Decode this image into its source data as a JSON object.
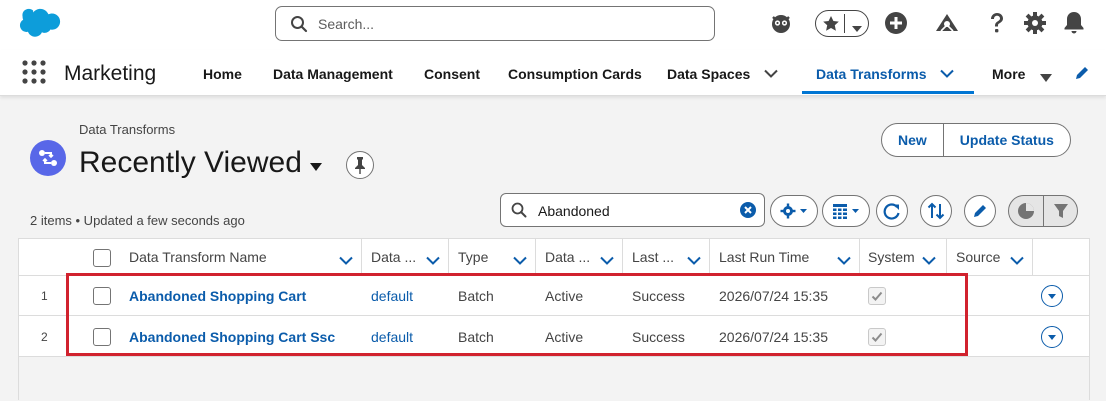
{
  "header": {
    "search_placeholder": "Search...",
    "icons": [
      "agent-icon",
      "favorites-star-icon",
      "add-icon",
      "trailhead-icon",
      "help-icon",
      "setup-gear-icon",
      "notifications-bell-icon"
    ]
  },
  "nav": {
    "app_name": "Marketing",
    "items": [
      {
        "label": "Home"
      },
      {
        "label": "Data Management"
      },
      {
        "label": "Consent"
      },
      {
        "label": "Consumption Cards"
      },
      {
        "label": "Data Spaces"
      },
      {
        "label": "Data Transforms"
      }
    ],
    "more_label": "More",
    "active": "Data Transforms",
    "accent": "#0176d3"
  },
  "list_view": {
    "breadcrumb": "Data Transforms",
    "title": "Recently Viewed",
    "meta": "2 items • Updated a few seconds ago",
    "buttons": {
      "new": "New",
      "update_status": "Update Status"
    },
    "search_value": "Abandoned"
  },
  "table": {
    "columns": [
      "Data Transform Name",
      "Data ...",
      "Type",
      "Data ...",
      "Last ...",
      "Last Run Time",
      "System",
      "Source"
    ],
    "rows": [
      {
        "num": "1",
        "name": "Abandoned Shopping Cart",
        "dataspace": "default",
        "type": "Batch",
        "status": "Active",
        "last_status": "Success",
        "last_run": "2026/07/24 15:35",
        "system": true,
        "source": ""
      },
      {
        "num": "2",
        "name": "Abandoned Shopping Cart Ssc",
        "dataspace": "default",
        "type": "Batch",
        "status": "Active",
        "last_status": "Success",
        "last_run": "2026/07/24 15:35",
        "system": true,
        "source": ""
      }
    ]
  },
  "colors": {
    "link": "#0b5cab",
    "highlight_box": "#d1222e",
    "brand_cloud": "#0d9dda",
    "object_icon": "#5867e8"
  }
}
